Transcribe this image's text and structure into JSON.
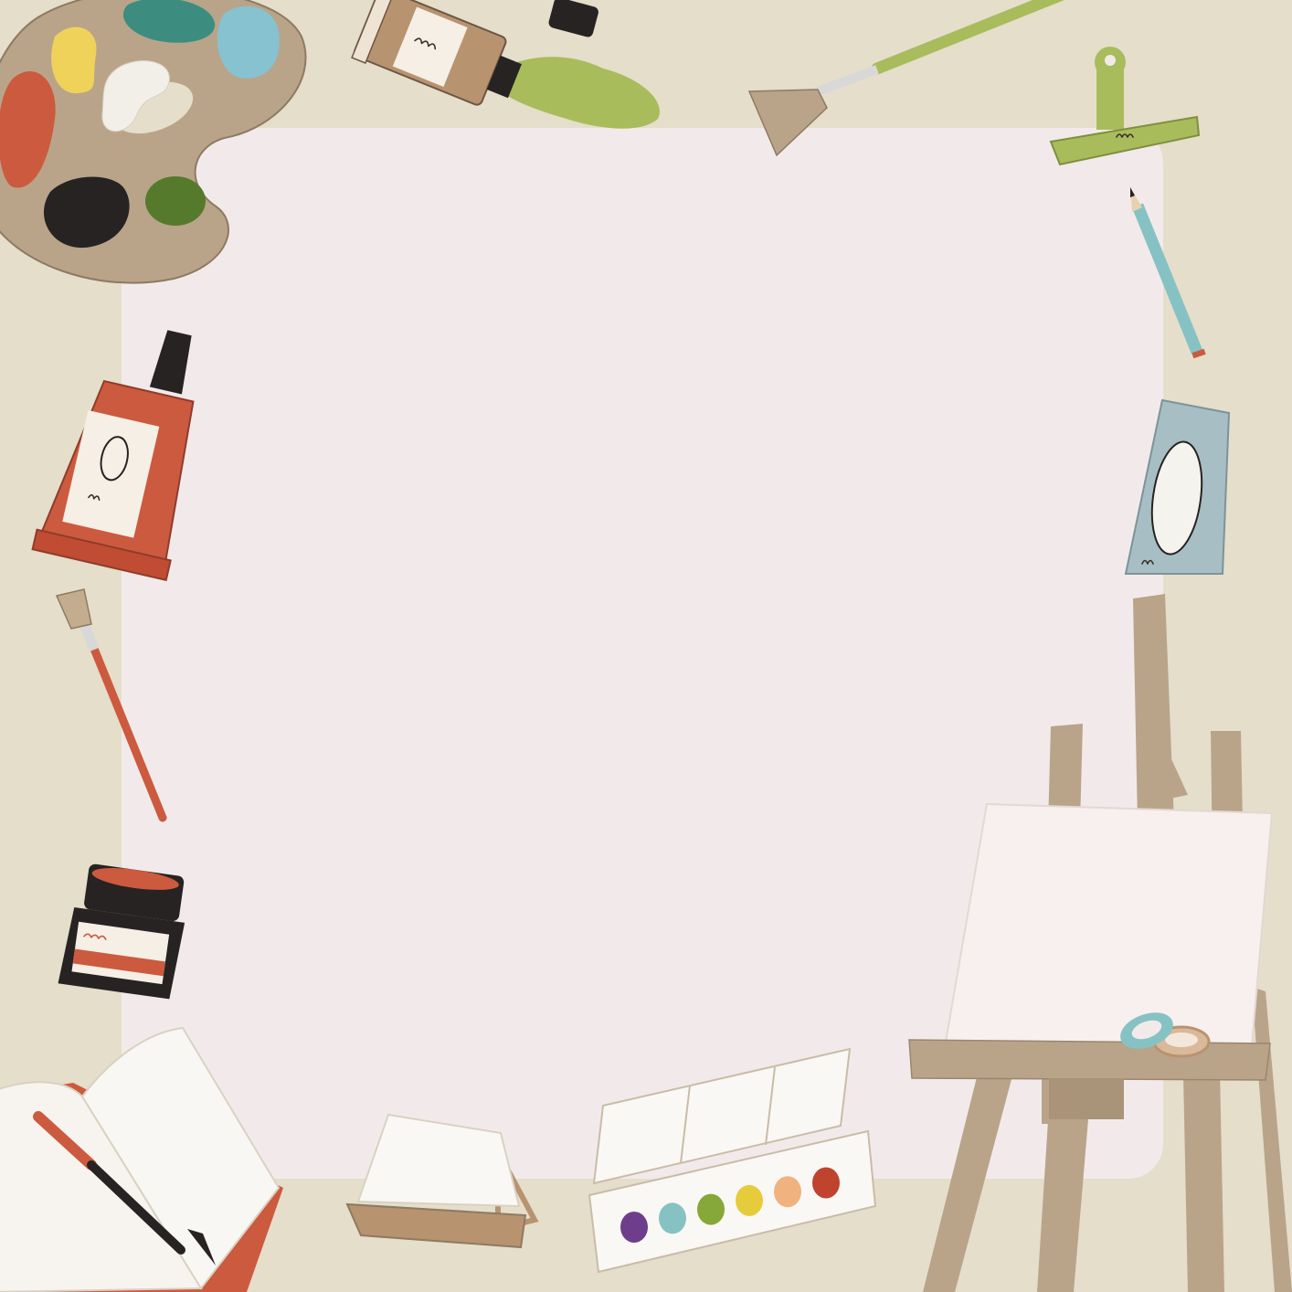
{
  "frame": {
    "background_color": "#e4decb",
    "panel_color": "#f2eaea"
  },
  "palette": {
    "wood_color": "#b9a48a",
    "paint_colors": [
      "#efd25a",
      "#3c8d80",
      "#86c2d0",
      "#cc5a3e",
      "#f2efe8",
      "#262322",
      "#567a2c"
    ]
  },
  "watercolor_set": {
    "pan_colors": [
      "#6e3e8c",
      "#86c2c4",
      "#86a838",
      "#e6cc3a",
      "#f0b27e",
      "#c0432e"
    ]
  },
  "icons": [
    "paint-palette-icon",
    "paint-tube-icon",
    "fan-brush-icon",
    "clip-icon",
    "pencil-icon",
    "flat-brush-icon",
    "ink-bottle-icon",
    "sketchbook-icon",
    "pen-icon",
    "tabletop-easel-icon",
    "watercolor-set-icon",
    "easel-icon",
    "canvas-icon",
    "tape-roll-icon"
  ]
}
